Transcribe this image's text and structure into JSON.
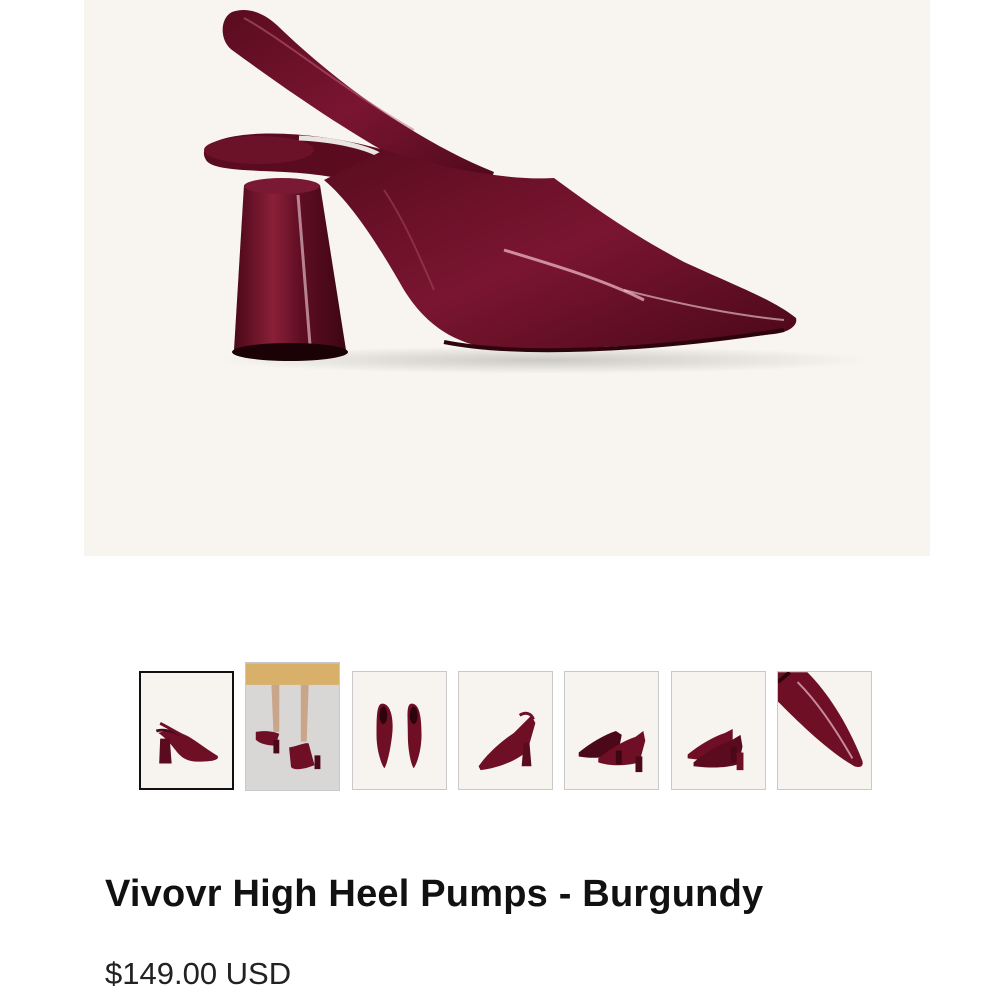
{
  "product": {
    "title": "Vivovr High Heel Pumps - Burgundy",
    "price": "$149.00 USD"
  },
  "gallery": {
    "selected_index": 0,
    "thumbnails": [
      {
        "view": "side-profile"
      },
      {
        "view": "worn-by-model"
      },
      {
        "view": "top-pair"
      },
      {
        "view": "inner-side"
      },
      {
        "view": "pair-side"
      },
      {
        "view": "pair-angle"
      },
      {
        "view": "toe-closeup"
      }
    ]
  },
  "colors": {
    "burgundy": "#6e0f26",
    "burgundy_dark": "#4a0818",
    "hero_background": "#f8f5f0",
    "selected_border": "#111111"
  }
}
